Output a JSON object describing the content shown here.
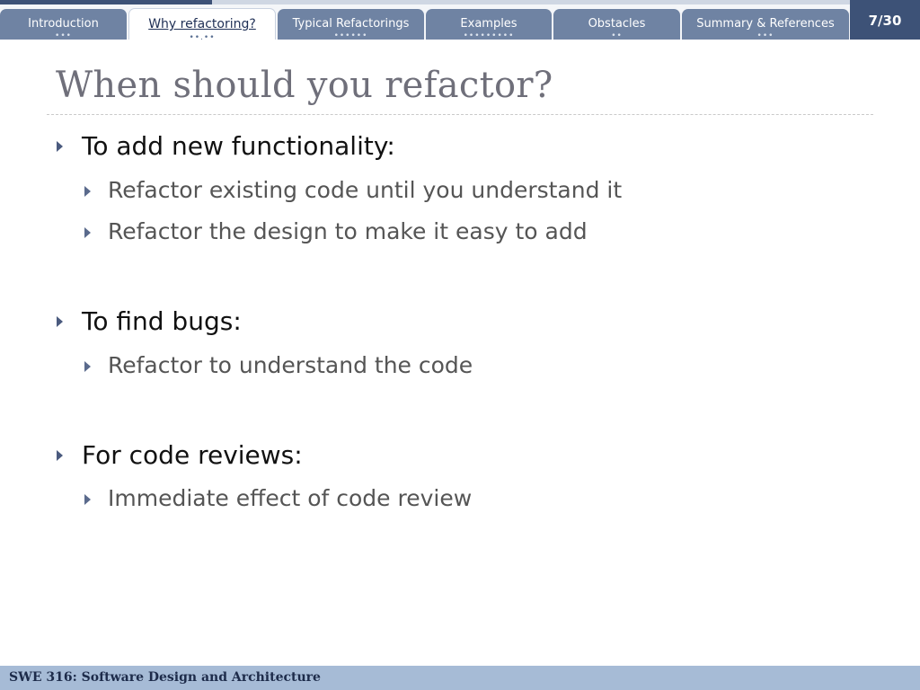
{
  "nav": {
    "tabs": [
      {
        "label": "Introduction",
        "dots": "•••"
      },
      {
        "label": "Why refactoring?",
        "dots": "••.••"
      },
      {
        "label": "Typical Refactorings",
        "dots": "••••••"
      },
      {
        "label": "Examples",
        "dots": "•••••••••"
      },
      {
        "label": "Obstacles",
        "dots": "••"
      },
      {
        "label": "Summary & References",
        "dots": "•••"
      }
    ],
    "active_tab": "Why refactoring?",
    "page_counter": "7/30",
    "progress_fraction": 0.23
  },
  "slide": {
    "title": "When should you refactor?",
    "sections": [
      {
        "heading": "To add new functionality:",
        "items": [
          "Refactor existing code until you understand it",
          "Refactor the design to make it easy to add"
        ]
      },
      {
        "heading": "To find bugs:",
        "items": [
          "Refactor to understand the code"
        ]
      },
      {
        "heading": "For code reviews:",
        "items": [
          "Immediate effect of code review"
        ]
      }
    ]
  },
  "footer": {
    "course": "SWE 316: Software Design and Architecture"
  },
  "colors": {
    "tab_bg": "#6f83a3",
    "counter_bg": "#3d5277",
    "footer_bg": "#a6bbd6",
    "title": "#6f6f7a"
  }
}
